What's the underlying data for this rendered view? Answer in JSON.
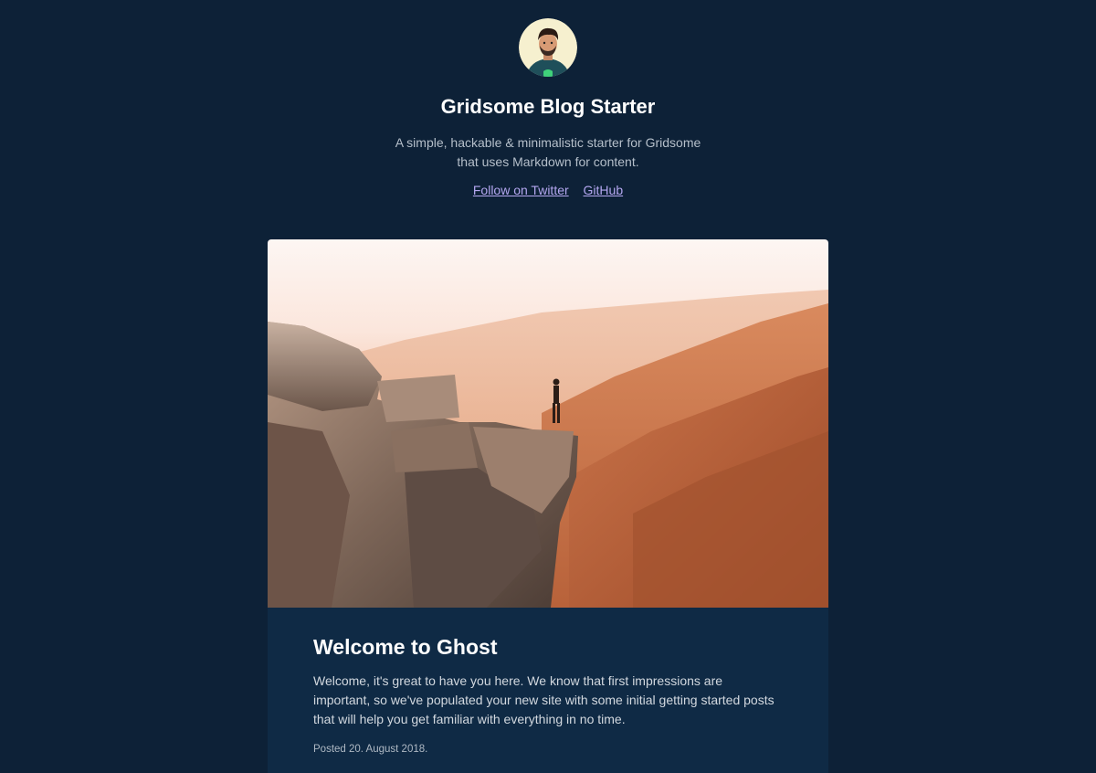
{
  "header": {
    "avatar_icon": "author-avatar",
    "title": "Gridsome Blog Starter",
    "description": "A simple, hackable & minimalistic starter for Gridsome that uses Markdown for content.",
    "links": [
      {
        "label": "Follow on Twitter"
      },
      {
        "label": "GitHub"
      }
    ]
  },
  "post": {
    "cover_icon": "cover-image",
    "title": "Welcome to Ghost",
    "excerpt": "Welcome, it's great to have you here. We know that first impressions are important, so we've populated your new site with some initial getting started posts that will help you get familiar with everything in no time.",
    "date": "Posted 20. August 2018."
  },
  "colors": {
    "background": "#0d2137",
    "card": "#0f2a45",
    "link": "#b4a7f0"
  }
}
